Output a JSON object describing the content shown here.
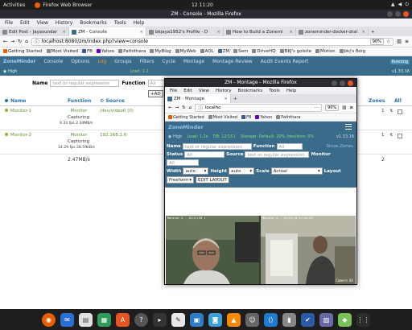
{
  "topbar": {
    "activities": "Activities",
    "app_name": "Firefox Web Browser",
    "clock": "12 11:20"
  },
  "main": {
    "title": "ZM - Console - Mozilla Firefox",
    "menu": [
      "File",
      "Edit",
      "View",
      "History",
      "Bookmarks",
      "Tools",
      "Help"
    ],
    "tabs": [
      {
        "label": "Edit Post ‹ Jayasundar"
      },
      {
        "label": "ZM - Console"
      },
      {
        "label": "bkjaya1952's Profile - D"
      },
      {
        "label": "How to Build a Zonemi"
      },
      {
        "label": "zoneminder-docker-dral"
      }
    ],
    "url": "localhost:8080/zm/index.php?view=console",
    "zoom": "90%",
    "bookmarks": [
      "Getting Started",
      "Most Visited",
      "FB",
      "Yahoo",
      "Pathithara",
      "MyBlog",
      "MyWeb",
      "AOL",
      "ZM",
      "Sem",
      "DriveHQ",
      "BKJ's golsite",
      "Motion",
      "bkj's Bolg"
    ],
    "zm": {
      "nav": [
        "ZoneMinder",
        "Console",
        "Options",
        "Log",
        "Groups",
        "Filters",
        "Cycle",
        "Montage",
        "Montage Review",
        "Audit Events Report"
      ],
      "running": "Running",
      "high": "High",
      "load": "Load: 1.2",
      "version": "v1.33.16",
      "name_label": "Name",
      "name_placeholder": "text or regular expression",
      "function_label": "Function",
      "function_value": "All",
      "add_label": "AD",
      "columns": {
        "name": "Name",
        "function": "Function",
        "source": "Source",
        "zones": "Zones",
        "all": "All"
      },
      "monitors": [
        {
          "name": "Monitor-1",
          "function": "Monitor",
          "status": "Capturing",
          "fps": "9.33 fps 2.44MB/s",
          "source": "/dev/video0 (0)",
          "zones": "1"
        },
        {
          "name": "Monitor-2",
          "function": "Monitor",
          "status": "Capturing",
          "fps": "14.29 fps 28.59kB/s",
          "source": "192.168.1.6",
          "zones": "1"
        }
      ],
      "total_bw": "2.47MB/s",
      "total_zones": "2"
    }
  },
  "montage": {
    "title": "ZM - Montage - Mozilla Firefox",
    "menu": [
      "File",
      "Edit",
      "View",
      "History",
      "Bookmarks",
      "Tools",
      "Help"
    ],
    "tab": "ZM - Montage",
    "url": "localho",
    "zoom": "90%",
    "bookmarks": [
      "Getting Started",
      "Most Visited",
      "FB",
      "Yahoo",
      "Paththara"
    ],
    "brand": "ZoneMinder",
    "high": "High",
    "load": "Load: 1.2x",
    "disk": "DB: 12/151",
    "storage": "Storage: Default: 20% /dev/shm: 0%",
    "version": "v1.33.16",
    "form": {
      "name_label": "Name",
      "name_placeholder": "text or regular expression",
      "function_label": "Function",
      "function_value": "All",
      "show_zones": "Show Zones",
      "status_label": "Status",
      "status_value": "All",
      "source_label": "Source",
      "source_placeholder": "text or regular expression",
      "monitor_label": "Monitor",
      "monitor_value": "All",
      "width_label": "Width",
      "width_value": "auto",
      "height_label": "Height",
      "height_value": "auto",
      "scale_label": "Scale",
      "scale_value": "Actual",
      "layout_label": "Layout",
      "layout_value": "Freeform",
      "edit_layout": "EDIT LAYOUT"
    },
    "cam1_label": "Monitor-1 - 12/17/20 1",
    "cam2_label": "Monitor-2 - 15/12/19 11:20:52",
    "cam2_ts": "Camera 01"
  },
  "dock": [
    "firefox",
    "mail",
    "files",
    "libreoffice",
    "appstore",
    "help",
    "terminal",
    "editor",
    "vm",
    "camera",
    "vlc",
    "people",
    "vscode",
    "usb",
    "docs",
    "image",
    "android",
    "apps"
  ],
  "colors": {
    "zm_header": "#3b6b8a",
    "accent": "#e95420"
  }
}
